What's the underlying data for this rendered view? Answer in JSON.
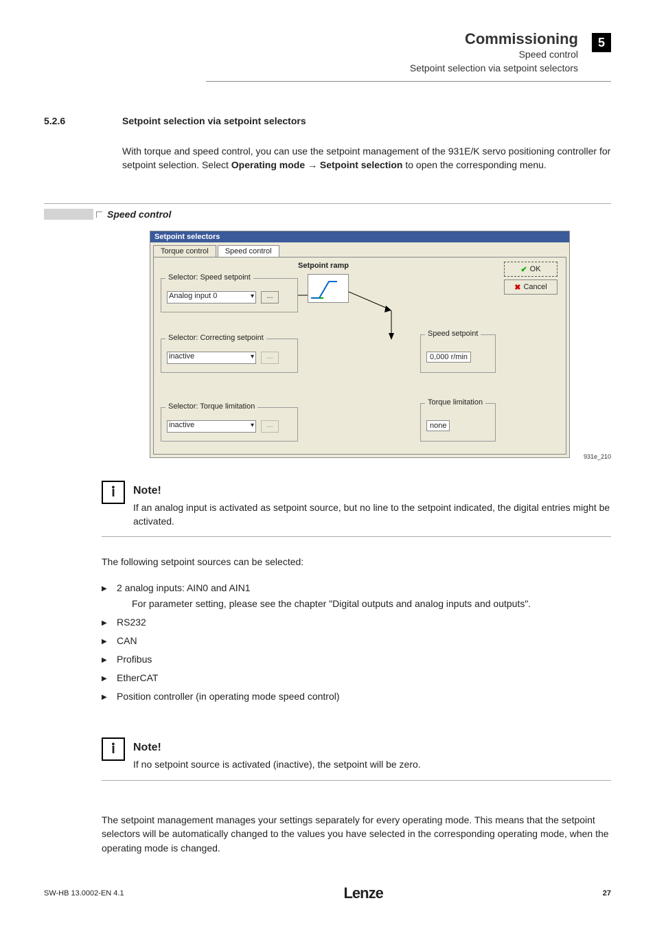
{
  "chapter_badge": "5",
  "header": {
    "title": "Commissioning",
    "sub1": "Speed control",
    "sub2": "Setpoint selection via setpoint selectors"
  },
  "section": {
    "number": "5.2.6",
    "title": "Setpoint selection via setpoint selectors",
    "intro_a": "With torque and speed control, you can use the setpoint management of the 931E/K servo positioning controller for setpoint selection. Select ",
    "intro_b": "Operating mode → Setpoint selection",
    "intro_c": " to open the corresponding menu."
  },
  "speed_control_label": "Speed control",
  "win": {
    "title": "Setpoint selectors",
    "tab1": "Torque control",
    "tab2": "Speed control",
    "ramp_label": "Setpoint ramp",
    "ok": "OK",
    "cancel": "Cancel",
    "grp1_title": "Selector: Speed setpoint",
    "grp1_value": "Analog input 0",
    "grp2_title": "Selector: Correcting setpoint",
    "grp2_value": "inactive",
    "grp3_title": "Selector: Torque limitation",
    "grp3_value": "inactive",
    "dots": "...",
    "out1_title": "Speed setpoint",
    "out1_value": "0,000  r/min",
    "out2_title": "Torque limitation",
    "out2_value": "none"
  },
  "fig_ref": "931e_210",
  "note1": {
    "head": "Note!",
    "body": "If an analog input is activated as setpoint source, but no line to the setpoint indicated, the digital entries might be activated."
  },
  "following": "The following setpoint sources can be selected:",
  "bullets": {
    "b1": "2 analog inputs: AIN0 and AIN1",
    "b1sub": "For parameter setting, please see the chapter \"Digital outputs and analog inputs and outputs\".",
    "b2": "RS232",
    "b3": "CAN",
    "b4": "Profibus",
    "b5": "EtherCAT",
    "b6": "Position controller (in operating mode speed control)"
  },
  "note2": {
    "head": "Note!",
    "body": "If no setpoint source is activated (inactive), the setpoint will be zero."
  },
  "final": "The setpoint management manages your settings separately for every operating mode. This means that the setpoint selectors will be automatically changed to the values you have selected in the corresponding operating mode, when the operating mode is changed.",
  "footer": {
    "left": "SW-HB 13.0002-EN    4.1",
    "logo": "Lenze",
    "page": "27"
  }
}
